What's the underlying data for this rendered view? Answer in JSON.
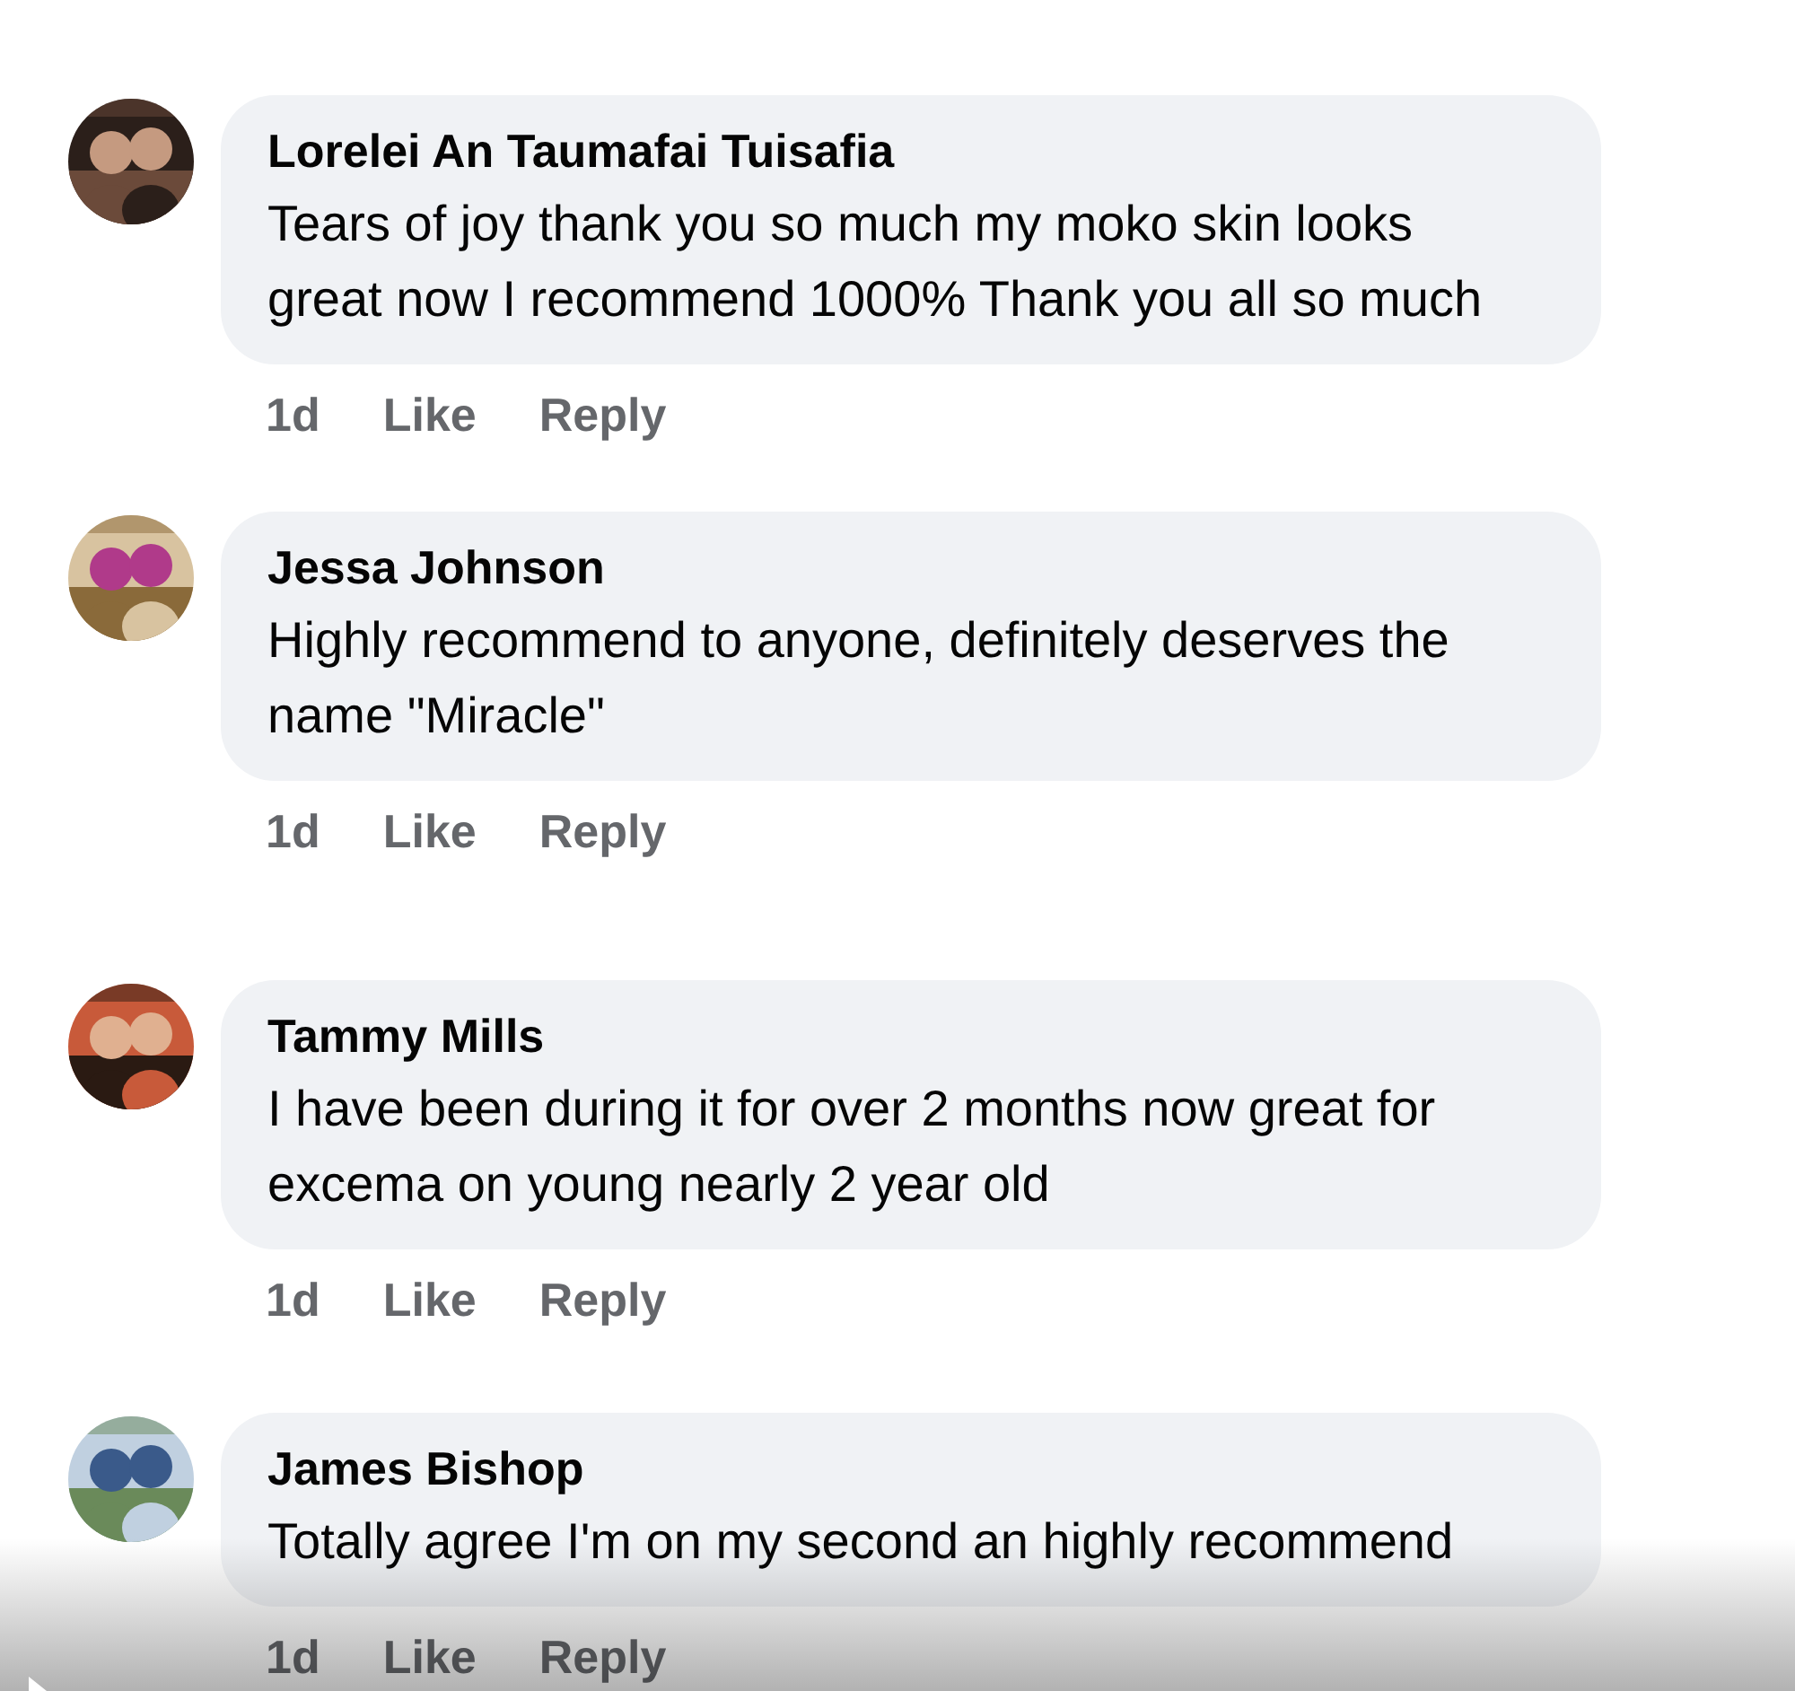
{
  "comments": [
    {
      "author": "Lorelei An Taumafai Tuisafia",
      "text": "Tears of joy thank you so much my moko skin looks great now I recommend 1000% Thank you all so much",
      "time": "1d",
      "actions": [
        "Like",
        "Reply"
      ]
    },
    {
      "author": "Jessa Johnson",
      "text": "Highly recommend to anyone, definitely deserves the name \"Miracle\"",
      "time": "1d",
      "actions": [
        "Like",
        "Reply"
      ]
    },
    {
      "author": "Tammy Mills",
      "text": "I have been during it for over 2 months now great for excema on young nearly 2 year old",
      "time": "1d",
      "actions": [
        "Like",
        "Reply"
      ]
    },
    {
      "author": "James Bishop",
      "text": "Totally agree I'm on my second an highly recommend",
      "time": "1d",
      "actions": [
        "Like",
        "Reply"
      ]
    }
  ],
  "player": {
    "kind": "video-controls"
  }
}
